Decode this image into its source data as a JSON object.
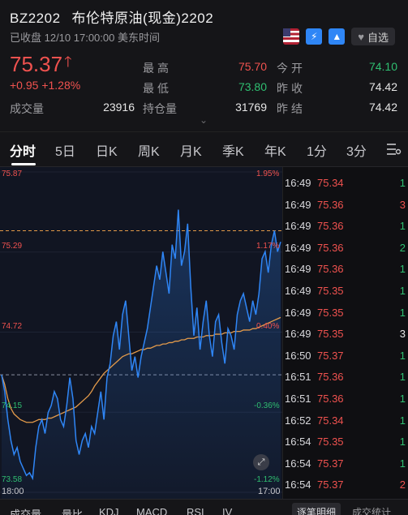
{
  "header": {
    "code": "BZ2202",
    "name": "布伦特原油(现金)2202",
    "status": "已收盘 12/10 17:00:00 美东时间",
    "watch_label": "自选",
    "price": "75.37",
    "change": "+0.95",
    "change_pct": "+1.28%",
    "volume_label": "成交量",
    "volume_value": "23916"
  },
  "stats": {
    "high_label": "最高",
    "high_value": "75.70",
    "low_label": "最低",
    "low_value": "73.80",
    "oi_label": "持仓量",
    "oi_value": "31769",
    "open_label": "今开",
    "open_value": "74.10",
    "prev_close_label": "昨收",
    "prev_close_value": "74.42",
    "prev_settle_label": "昨结",
    "prev_settle_value": "74.42"
  },
  "tabs": [
    "分时",
    "5日",
    "日K",
    "周K",
    "月K",
    "季K",
    "年K",
    "1分",
    "3分"
  ],
  "icons": {
    "flag": "us-flag-icon",
    "bolt": "lightning-icon",
    "tri": "triangle-icon",
    "heart": "heart-icon",
    "menu": "settings-menu-icon",
    "fullscreen": "fullscreen-icon"
  },
  "colors": {
    "up": "#f0524f",
    "down": "#2fbf71",
    "line": "#2f86f6",
    "avg": "#e39a4a",
    "bg": "#0f0f12"
  },
  "chart_data": {
    "type": "line",
    "ylim": [
      73.58,
      75.87
    ],
    "prev_close": 74.42,
    "y_ticks_left": [
      "75.87",
      "75.29",
      "74.72",
      "74.15",
      "73.58"
    ],
    "y_ticks_right": [
      "1.95%",
      "1.17%",
      "0.40%",
      "-0.36%",
      "-1.12%"
    ],
    "x_labels": [
      "18:00",
      "17:00"
    ],
    "series": [
      {
        "values": [
          74.42,
          74.3,
          74.1,
          73.95,
          73.85,
          73.9,
          73.8,
          73.75,
          73.7,
          73.72,
          73.68,
          73.9,
          74.05,
          74.1,
          74.0,
          74.15,
          74.2,
          74.3,
          74.25,
          74.1,
          74.05,
          74.2,
          74.4,
          74.25,
          73.95,
          73.85,
          73.95,
          74.0,
          73.9,
          74.05,
          74.0,
          74.15,
          74.3,
          74.1,
          74.4,
          74.5,
          74.7,
          74.8,
          74.6,
          74.85,
          74.95,
          74.7,
          74.45,
          74.55,
          74.4,
          74.55,
          74.65,
          74.75,
          74.9,
          75.05,
          75.2,
          75.1,
          75.3,
          75.15,
          75.0,
          75.35,
          75.25,
          75.6,
          75.2,
          75.3,
          75.5,
          75.05,
          74.7,
          74.9,
          74.6,
          74.8,
          74.95,
          74.7,
          74.55,
          74.8,
          74.85,
          74.65,
          74.5,
          74.75,
          74.7,
          74.6,
          74.85,
          74.95,
          75.0,
          74.9,
          74.8,
          74.95,
          74.85,
          75.0,
          75.25,
          75.3,
          75.15,
          75.35,
          75.45,
          75.3,
          75.37
        ]
      },
      {
        "values": [
          74.42,
          74.35,
          74.25,
          74.18,
          74.14,
          74.12,
          74.1,
          74.09,
          74.08,
          74.08,
          74.08,
          74.09,
          74.1,
          74.1,
          74.1,
          74.11,
          74.11,
          74.12,
          74.13,
          74.14,
          74.15,
          74.16,
          74.17,
          74.18,
          74.19,
          74.21,
          74.23,
          74.25,
          74.27,
          74.3,
          74.34,
          74.37,
          74.4,
          74.43,
          74.45,
          74.47,
          74.49,
          74.51,
          74.53,
          74.55,
          74.56,
          74.57,
          74.57,
          74.58,
          74.59,
          74.6,
          74.6,
          74.61,
          74.61,
          74.62,
          74.63,
          74.63,
          74.64,
          74.64,
          74.65,
          74.65,
          74.66,
          74.66,
          74.67,
          74.67,
          74.68,
          74.68,
          74.68,
          74.69,
          74.69,
          74.69,
          74.7,
          74.7,
          74.7,
          74.71,
          74.71,
          74.71,
          74.72,
          74.72,
          74.72,
          74.73,
          74.73,
          74.73,
          74.74,
          74.74,
          74.74,
          74.75,
          74.75,
          74.76,
          74.77,
          74.78,
          74.79,
          74.8,
          74.81,
          74.82,
          74.83
        ]
      }
    ]
  },
  "ticks": [
    {
      "t": "16:49",
      "p": "75.34",
      "v": "1",
      "c": "green"
    },
    {
      "t": "16:49",
      "p": "75.36",
      "v": "3",
      "c": "red"
    },
    {
      "t": "16:49",
      "p": "75.36",
      "v": "1",
      "c": "green"
    },
    {
      "t": "16:49",
      "p": "75.36",
      "v": "2",
      "c": "green"
    },
    {
      "t": "16:49",
      "p": "75.36",
      "v": "1",
      "c": "green"
    },
    {
      "t": "16:49",
      "p": "75.35",
      "v": "1",
      "c": "green"
    },
    {
      "t": "16:49",
      "p": "75.35",
      "v": "1",
      "c": "green"
    },
    {
      "t": "16:49",
      "p": "75.35",
      "v": "3",
      "c": "white"
    },
    {
      "t": "16:50",
      "p": "75.37",
      "v": "1",
      "c": "green"
    },
    {
      "t": "16:51",
      "p": "75.36",
      "v": "1",
      "c": "green"
    },
    {
      "t": "16:51",
      "p": "75.36",
      "v": "1",
      "c": "green"
    },
    {
      "t": "16:52",
      "p": "75.34",
      "v": "1",
      "c": "green"
    },
    {
      "t": "16:54",
      "p": "75.35",
      "v": "1",
      "c": "green"
    },
    {
      "t": "16:54",
      "p": "75.37",
      "v": "1",
      "c": "green"
    },
    {
      "t": "16:54",
      "p": "75.37",
      "v": "2",
      "c": "red"
    }
  ],
  "bottom_tabs": [
    "成交量",
    "量比",
    "KDJ",
    "MACD",
    "RSI",
    "IV"
  ],
  "bottom_right_tabs": [
    "逐笔明细",
    "成交统计"
  ]
}
